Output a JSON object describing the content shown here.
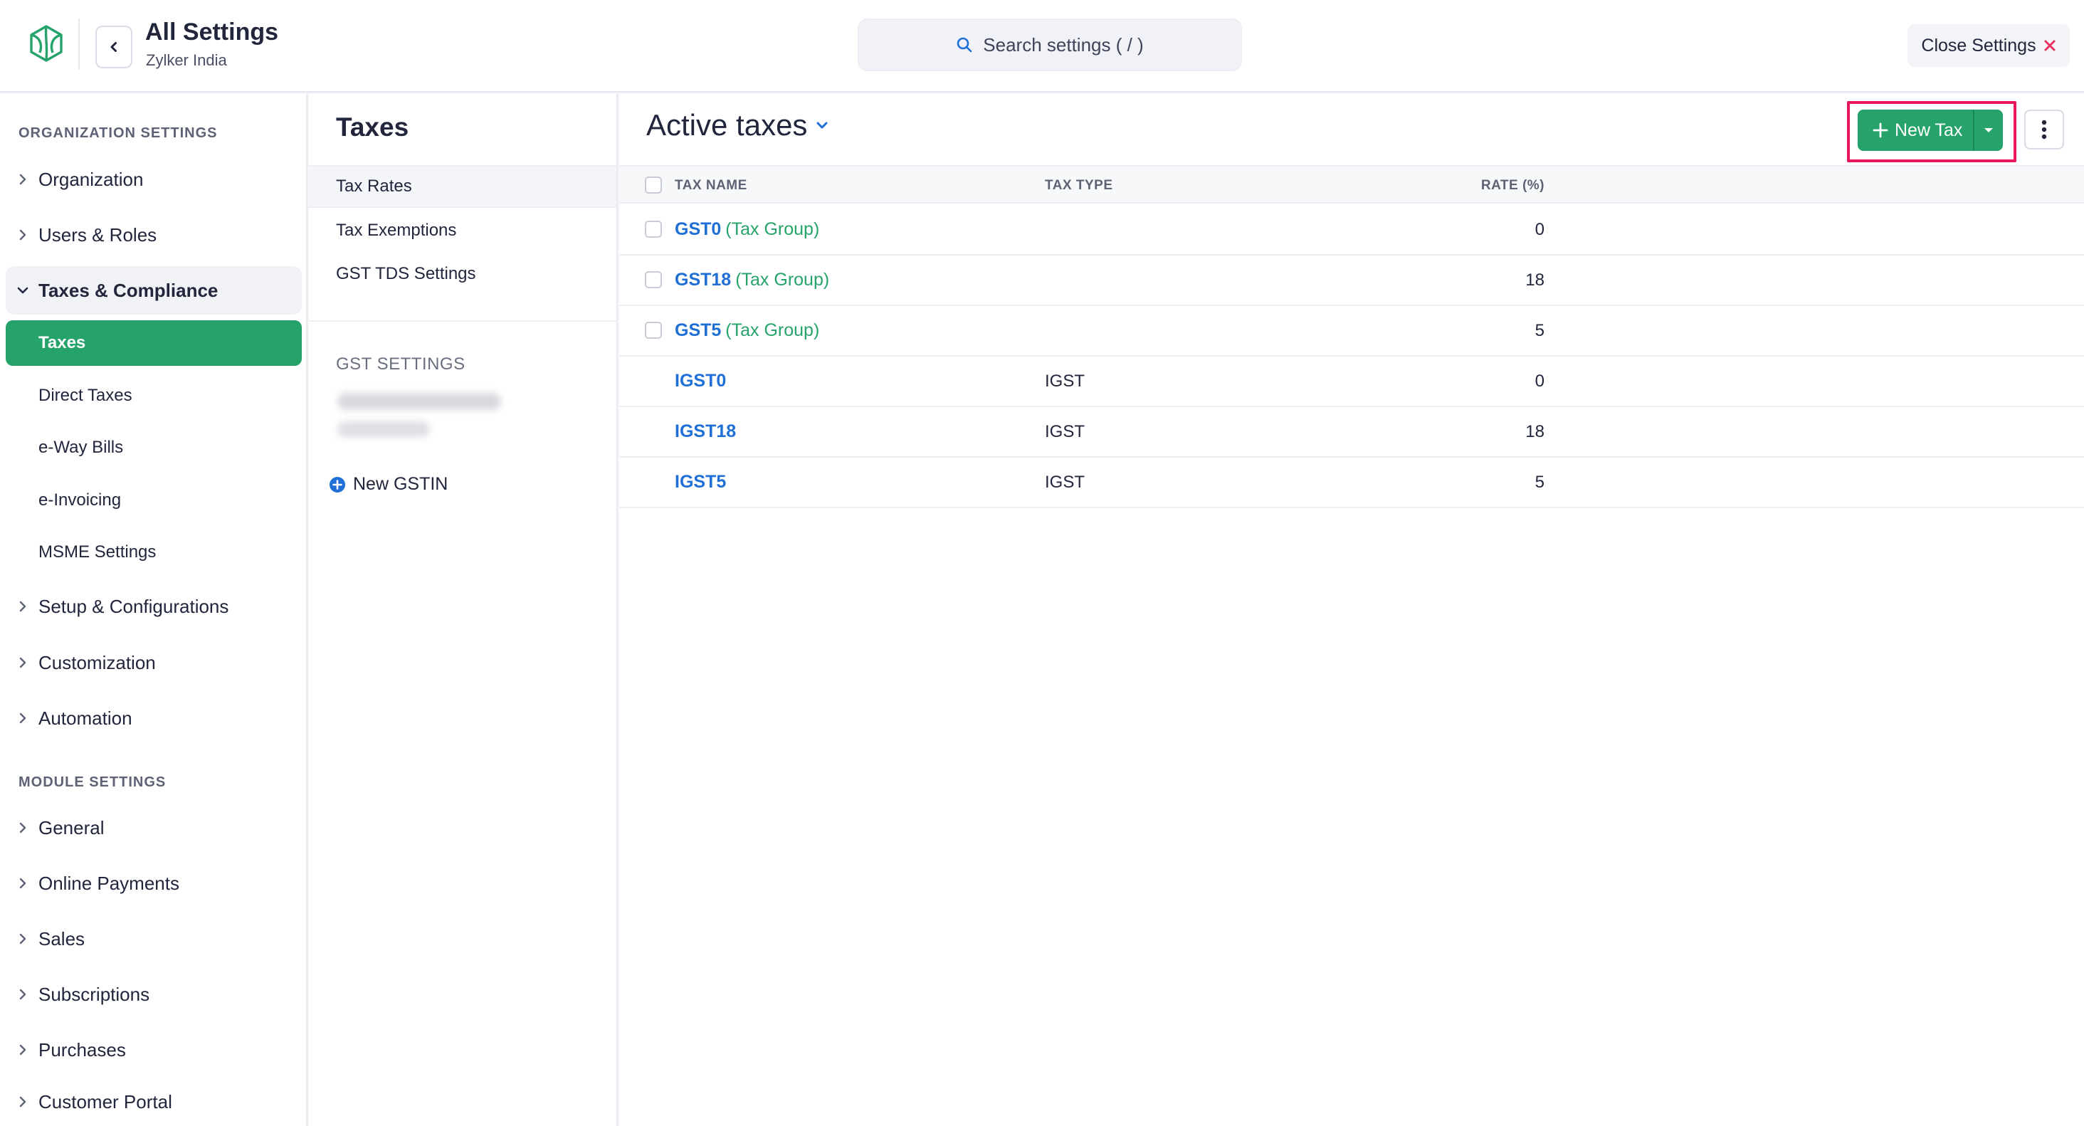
{
  "header": {
    "title": "All Settings",
    "org_name": "Zylker India",
    "search_placeholder": "Search settings ( / )",
    "close_label": "Close Settings"
  },
  "sidebar": {
    "org_section": "ORGANIZATION SETTINGS",
    "org_items": [
      {
        "label": "Organization"
      },
      {
        "label": "Users & Roles"
      },
      {
        "label": "Taxes & Compliance",
        "expanded": true
      }
    ],
    "taxes_children": [
      {
        "label": "Taxes",
        "active": true
      },
      {
        "label": "Direct Taxes"
      },
      {
        "label": "e-Way Bills"
      },
      {
        "label": "e-Invoicing"
      },
      {
        "label": "MSME Settings"
      }
    ],
    "org_items_after": [
      {
        "label": "Setup & Configurations"
      },
      {
        "label": "Customization"
      },
      {
        "label": "Automation"
      }
    ],
    "module_section": "MODULE SETTINGS",
    "module_items": [
      {
        "label": "General"
      },
      {
        "label": "Online Payments"
      },
      {
        "label": "Sales"
      },
      {
        "label": "Subscriptions"
      },
      {
        "label": "Purchases"
      },
      {
        "label": "Customer Portal"
      }
    ]
  },
  "taxes_panel": {
    "title": "Taxes",
    "items": [
      {
        "label": "Tax Rates",
        "active": true
      },
      {
        "label": "Tax Exemptions"
      },
      {
        "label": "GST TDS Settings"
      }
    ],
    "gst_section": "GST SETTINGS",
    "new_gstin_label": "New GSTIN"
  },
  "main": {
    "view_title": "Active taxes",
    "new_tax_label": "New Tax",
    "columns": {
      "name": "TAX NAME",
      "type": "TAX TYPE",
      "rate": "RATE (%)"
    },
    "rows": [
      {
        "name": "GST0",
        "group": "(Tax Group)",
        "type": "",
        "rate": "0"
      },
      {
        "name": "GST18",
        "group": "(Tax Group)",
        "type": "",
        "rate": "18"
      },
      {
        "name": "GST5",
        "group": "(Tax Group)",
        "type": "",
        "rate": "5"
      },
      {
        "name": "IGST0",
        "group": "",
        "type": "IGST",
        "rate": "0"
      },
      {
        "name": "IGST18",
        "group": "",
        "type": "IGST",
        "rate": "18"
      },
      {
        "name": "IGST5",
        "group": "",
        "type": "IGST",
        "rate": "5"
      }
    ]
  },
  "colors": {
    "accent_green": "#26a36a",
    "link_blue": "#1f6fd6",
    "highlight_pink": "#e8175d",
    "close_red": "#e8335a"
  }
}
